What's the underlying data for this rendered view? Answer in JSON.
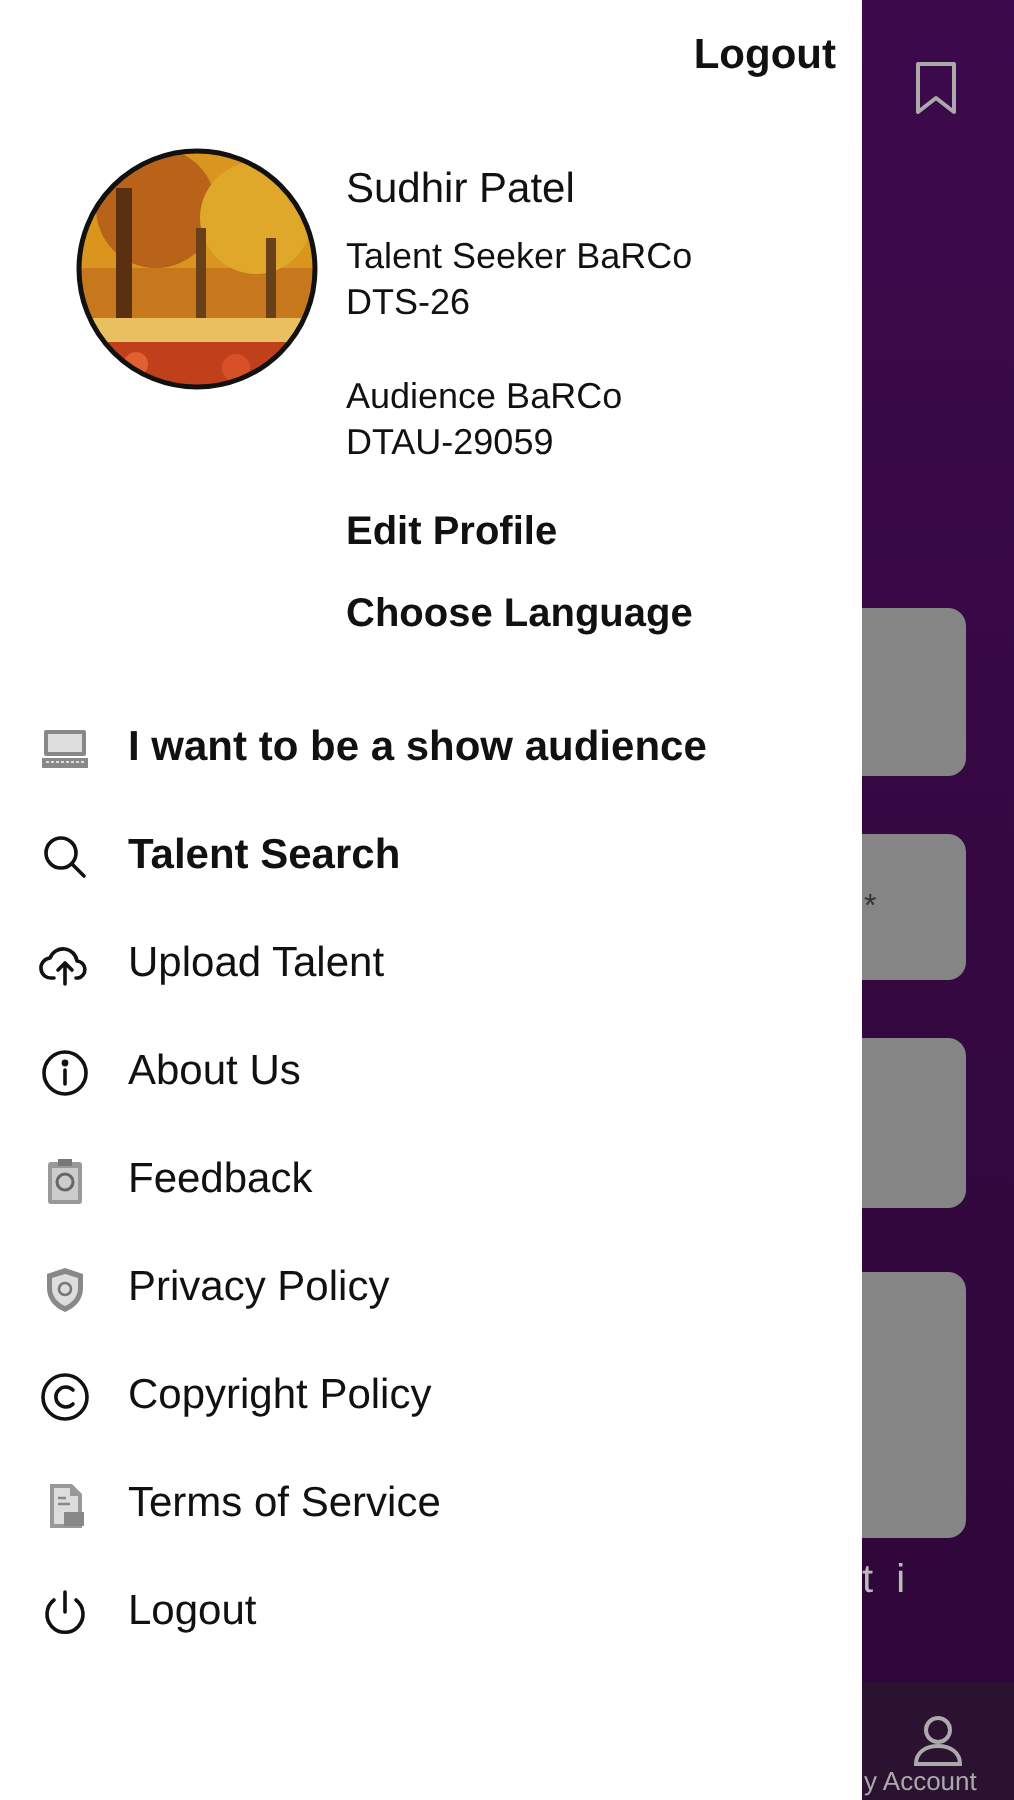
{
  "drawer": {
    "logout_link": "Logout",
    "profile": {
      "name": "Sudhir Patel",
      "lines": [
        "Talent Seeker BaRCo",
        "DTS-26",
        "Audience BaRCo",
        "DTAU-29059"
      ],
      "actions": [
        "Edit Profile",
        "Choose Language"
      ]
    },
    "menu": [
      {
        "label": "I want to be a show audience",
        "emphasized": true
      },
      {
        "label": "Talent Search",
        "emphasized": true
      },
      {
        "label": "Upload Talent",
        "emphasized": false
      },
      {
        "label": "About Us",
        "emphasized": false
      },
      {
        "label": "Feedback",
        "emphasized": false
      },
      {
        "label": "Privacy Policy",
        "emphasized": false
      },
      {
        "label": "Copyright Policy",
        "emphasized": false
      },
      {
        "label": "Terms of Service",
        "emphasized": false
      },
      {
        "label": "Logout",
        "emphasized": false
      }
    ]
  },
  "background": {
    "second_card_mark": "*",
    "partial_text": "t i",
    "tab_label": "y Account"
  }
}
